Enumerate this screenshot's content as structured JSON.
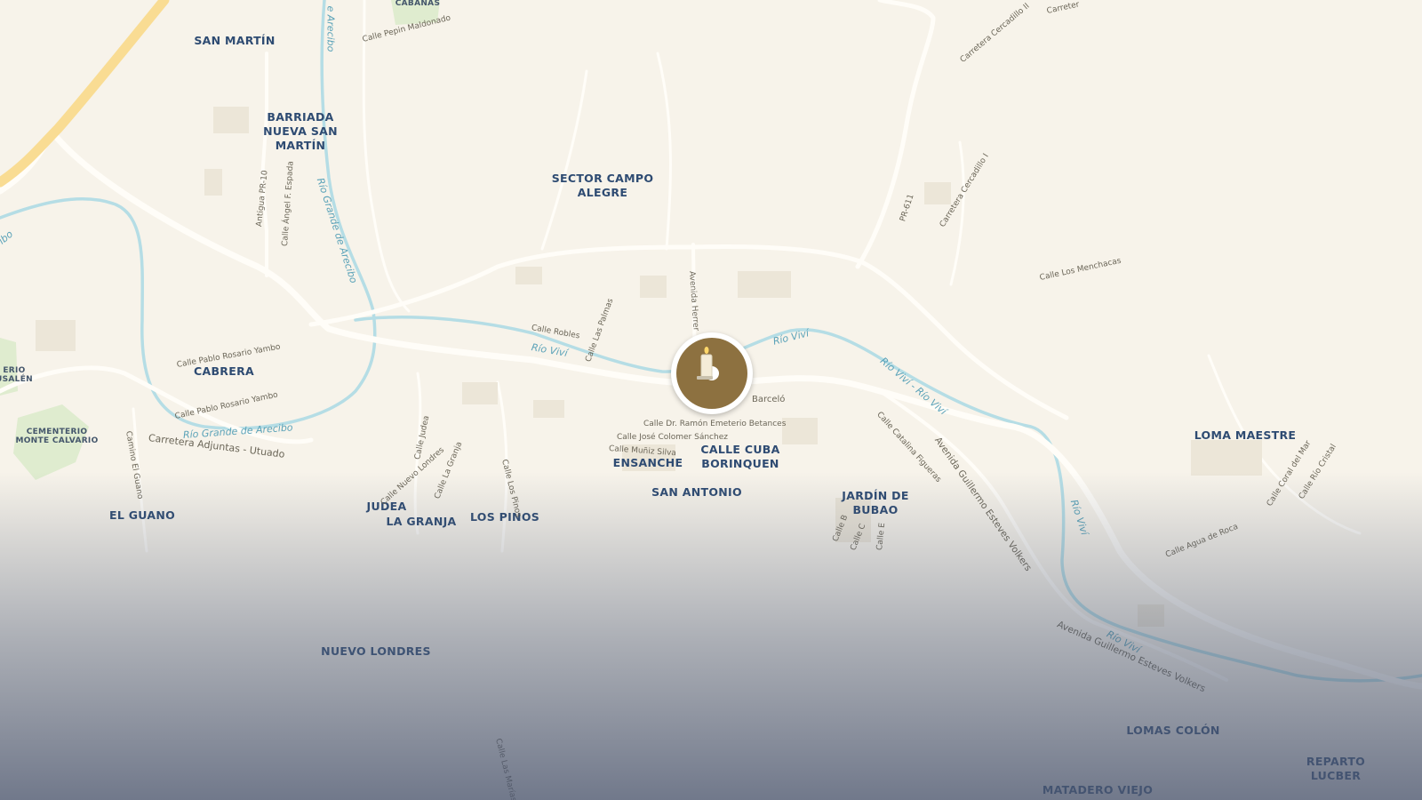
{
  "map": {
    "colors": {
      "land": "#f7f3ea",
      "road": "#fffdf8",
      "highway": "#f9dc93",
      "river": "#b5dde5",
      "label": "#2e4b72",
      "marker": "#8d7140",
      "green": "#dfeccf"
    },
    "neighborhoods": {
      "san_martin": "SAN MARTÍN",
      "barriada_nueva_san_martin": "BARRIADA\nNUEVA SAN\nMARTÍN",
      "sector_campo_alegre": "SECTOR CAMPO\nALEGRE",
      "cabrera": "CABRERA",
      "el_guano": "EL GUANO",
      "judea": "JUDEA",
      "la_granja": "LA GRANJA",
      "los_pinos": "LOS PINOS",
      "ensanche": "ENSANCHE",
      "calle_cuba_borinquen": "CALLE CUBA\nBORINQUEN",
      "san_antonio": "SAN ANTONIO",
      "jardin_de_bubao": "JARDÍN DE\nBUBAO",
      "loma_maestre": "LOMA MAESTRE",
      "nuevo_londres": "NUEVO LONDRES",
      "lomas_colon": "LOMAS COLÓN",
      "reparto_lucber": "REPARTO LUCBER",
      "matadero_viejo": "MATADERO VIEJO",
      "cementerio_monte_calvario": "CEMENTERIO\nMONTE CALVARIO",
      "cementerio_jerusalen": "ERIO\nUSALÉN",
      "cabanas": "CABANAS"
    },
    "streets": {
      "calle_pepin_maldonado": "Calle Pepin Maldonado",
      "carretera_cercadillo_ii": "Carretera Cercadillo II",
      "carretera_top": "Carreter",
      "antigua_pr10": "Antigua PR-10",
      "calle_angel_espada": "Calle Ángel F. Espada",
      "pr611": "PR-611",
      "carretera_cercadillo_i": "Carretera Cercadillo I",
      "calle_los_menchacas": "Calle Los Menchacas",
      "avenida_herrera": "Avenida Herrer",
      "calle_robles": "Calle Robles",
      "calle_las_palmas": "Calle Las Palmas",
      "calle_pablo_rosario_yambo_1": "Calle Pablo Rosario Yambo",
      "calle_pablo_rosario_yambo_2": "Calle Pablo Rosario Yambo",
      "carretera_adjuntas_utuado": "Carretera Adjuntas - Utuado",
      "camino_el_guano": "Camino El Guano",
      "calle_judea": "Calle Judea",
      "calle_nuevo_londres": "Calle Nuevo Londres",
      "calle_la_granja": "Calle La Granja",
      "calle_los_pinos": "Calle Los Pinos",
      "calle_barcelo": "Barceló",
      "calle_dr_betances": "Calle Dr. Ramón Emeterio Betances",
      "calle_jose_colomer": "Calle José Colomer Sánchez",
      "calle_muniz_silva": "Calle Muñiz Silva",
      "calle_catalina_figueras": "Calle Catalina Figueras",
      "avenida_guillermo_1": "Avenida Guillermo Esteves Volkers",
      "avenida_guillermo_2": "Avenida Guillermo Esteves Volkers",
      "calle_b": "Calle B",
      "calle_c": "Calle C",
      "calle_e": "Calle E",
      "calle_coral_del_mar": "Calle Coral del Mar",
      "calle_rio_cristal": "Calle Río Cristal",
      "calle_agua_de_roca": "Calle Agua de Roca",
      "calle_las_marias": "Calle Las Marías"
    },
    "rivers": {
      "rio_vivi_1": "Río Viví",
      "rio_vivi_2": "Río Viví",
      "rio_vivi_double": "Río Viví - Río Viví",
      "rio_vivi_3": "Río Viví",
      "rio_vivi_4": "Río Viví",
      "rio_grande_1": "Río Grande de Arecibo",
      "rio_grande_2": "Río Grande de Arecibo",
      "rio_grande_3": "e Arecibo",
      "rio_edge": "ibo"
    },
    "marker": {
      "icon": "candle-icon"
    }
  }
}
